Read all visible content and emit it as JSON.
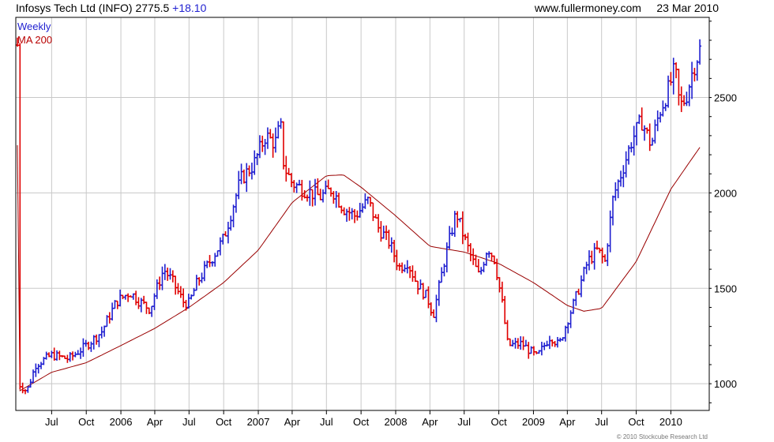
{
  "header": {
    "instrument": "Infosys Tech Ltd (INFO) 2775.5",
    "change": "+18.10",
    "source": "www.fullermoney.com",
    "date": "23 Mar 2010"
  },
  "legend": {
    "weekly": "Weekly",
    "ma": "MA 200"
  },
  "copyright": "© 2010 Stockcube Research Ltd",
  "colors": {
    "up": "#1f1fd0",
    "down": "#e00000",
    "ma": "#990000",
    "grid": "#c8c8c8",
    "frame": "#000000"
  },
  "chart_data": {
    "type": "ohlc",
    "interval": "weekly",
    "x_range": [
      "2005-04-01",
      "2010-03-23"
    ],
    "ylim": [
      860,
      2920
    ],
    "y_ticks": [
      1000,
      1500,
      2000,
      2500
    ],
    "y_tick_labels": [
      "1000",
      "1500",
      "2000",
      "2500"
    ],
    "x_tick_labels": [
      {
        "date": "2005-07-01",
        "label": "Jul"
      },
      {
        "date": "2005-10-01",
        "label": "Oct"
      },
      {
        "date": "2006-01-01",
        "label": "2006"
      },
      {
        "date": "2006-04-01",
        "label": "Apr"
      },
      {
        "date": "2006-07-01",
        "label": "Jul"
      },
      {
        "date": "2006-10-01",
        "label": "Oct"
      },
      {
        "date": "2007-01-01",
        "label": "2007"
      },
      {
        "date": "2007-04-01",
        "label": "Apr"
      },
      {
        "date": "2007-07-01",
        "label": "Jul"
      },
      {
        "date": "2007-10-01",
        "label": "Oct"
      },
      {
        "date": "2008-01-01",
        "label": "2008"
      },
      {
        "date": "2008-04-01",
        "label": "Apr"
      },
      {
        "date": "2008-07-01",
        "label": "Jul"
      },
      {
        "date": "2008-10-01",
        "label": "Oct"
      },
      {
        "date": "2009-01-01",
        "label": "2009"
      },
      {
        "date": "2009-04-01",
        "label": "Apr"
      },
      {
        "date": "2009-07-01",
        "label": "Jul"
      },
      {
        "date": "2009-10-01",
        "label": "Oct"
      },
      {
        "date": "2010-01-01",
        "label": "2010"
      }
    ],
    "price_anchors": [
      [
        "2005-04-05",
        1000
      ],
      [
        "2005-04-26",
        960
      ],
      [
        "2005-05-20",
        1100
      ],
      [
        "2005-07-01",
        1150
      ],
      [
        "2005-08-15",
        1130
      ],
      [
        "2005-10-01",
        1200
      ],
      [
        "2005-11-10",
        1270
      ],
      [
        "2005-12-20",
        1430
      ],
      [
        "2006-01-25",
        1480
      ],
      [
        "2006-02-20",
        1430
      ],
      [
        "2006-03-20",
        1390
      ],
      [
        "2006-04-01",
        1470
      ],
      [
        "2006-04-25",
        1600
      ],
      [
        "2006-05-20",
        1530
      ],
      [
        "2006-06-15",
        1430
      ],
      [
        "2006-07-01",
        1420
      ],
      [
        "2006-07-20",
        1520
      ],
      [
        "2006-08-25",
        1640
      ],
      [
        "2006-10-01",
        1760
      ],
      [
        "2006-11-15",
        2070
      ],
      [
        "2006-12-20",
        2150
      ],
      [
        "2007-01-20",
        2300
      ],
      [
        "2007-02-15",
        2260
      ],
      [
        "2007-03-01",
        2360
      ],
      [
        "2007-03-10",
        2140
      ],
      [
        "2007-04-01",
        2050
      ],
      [
        "2007-05-10",
        2010
      ],
      [
        "2007-06-15",
        1980
      ],
      [
        "2007-07-15",
        2020
      ],
      [
        "2007-08-15",
        1920
      ],
      [
        "2007-09-15",
        1880
      ],
      [
        "2007-10-20",
        1960
      ],
      [
        "2007-11-15",
        1820
      ],
      [
        "2007-12-15",
        1740
      ],
      [
        "2008-01-10",
        1610
      ],
      [
        "2008-02-01",
        1640
      ],
      [
        "2008-02-25",
        1530
      ],
      [
        "2008-03-25",
        1450
      ],
      [
        "2008-04-10",
        1360
      ],
      [
        "2008-05-10",
        1650
      ],
      [
        "2008-06-10",
        1900
      ],
      [
        "2008-06-25",
        1800
      ],
      [
        "2008-07-20",
        1660
      ],
      [
        "2008-08-10",
        1560
      ],
      [
        "2008-09-01",
        1720
      ],
      [
        "2008-09-20",
        1650
      ],
      [
        "2008-10-10",
        1420
      ],
      [
        "2008-10-25",
        1200
      ],
      [
        "2008-12-01",
        1210
      ],
      [
        "2009-01-10",
        1140
      ],
      [
        "2009-02-15",
        1250
      ],
      [
        "2009-03-10",
        1200
      ],
      [
        "2009-04-01",
        1330
      ],
      [
        "2009-04-25",
        1460
      ],
      [
        "2009-05-25",
        1640
      ],
      [
        "2009-06-20",
        1700
      ],
      [
        "2009-07-10",
        1640
      ],
      [
        "2009-08-01",
        1980
      ],
      [
        "2009-08-25",
        2120
      ],
      [
        "2009-09-20",
        2280
      ],
      [
        "2009-10-15",
        2380
      ],
      [
        "2009-11-10",
        2250
      ],
      [
        "2009-12-01",
        2420
      ],
      [
        "2009-12-25",
        2540
      ],
      [
        "2010-01-12",
        2650
      ],
      [
        "2010-01-25",
        2450
      ],
      [
        "2010-02-10",
        2500
      ],
      [
        "2010-03-01",
        2650
      ],
      [
        "2010-03-23",
        2775
      ]
    ],
    "ma200_anchors": [
      [
        "2005-04-05",
        960
      ],
      [
        "2005-07-01",
        1060
      ],
      [
        "2005-10-01",
        1110
      ],
      [
        "2006-01-01",
        1200
      ],
      [
        "2006-04-01",
        1290
      ],
      [
        "2006-07-01",
        1400
      ],
      [
        "2006-10-01",
        1530
      ],
      [
        "2007-01-01",
        1700
      ],
      [
        "2007-04-01",
        1950
      ],
      [
        "2007-07-01",
        2090
      ],
      [
        "2007-08-15",
        2095
      ],
      [
        "2007-10-01",
        2030
      ],
      [
        "2008-01-01",
        1880
      ],
      [
        "2008-04-01",
        1720
      ],
      [
        "2008-07-01",
        1690
      ],
      [
        "2008-10-01",
        1630
      ],
      [
        "2009-01-01",
        1530
      ],
      [
        "2009-04-01",
        1410
      ],
      [
        "2009-05-15",
        1380
      ],
      [
        "2009-07-01",
        1395
      ],
      [
        "2009-10-01",
        1640
      ],
      [
        "2010-01-01",
        2020
      ],
      [
        "2010-03-23",
        2250
      ]
    ]
  }
}
